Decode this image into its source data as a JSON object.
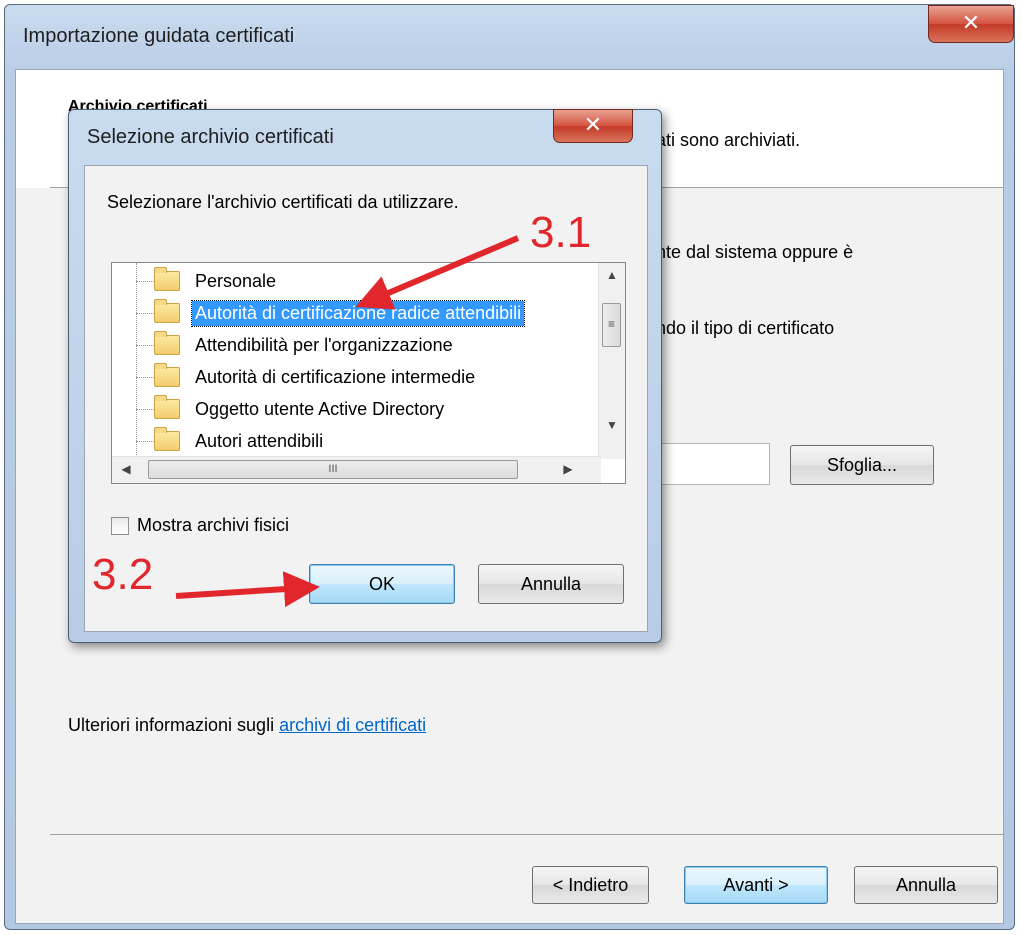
{
  "window": {
    "title": "Importazione guidata certificati",
    "close_glyph": "✕"
  },
  "wizard": {
    "header_title": "Archivio certificati",
    "header_desc_visible": "ati sono archiviati.",
    "line1_visible": "nte dal sistema oppure è",
    "line2_visible": "ndo il tipo di certificato",
    "browse_label": "Sfoglia...",
    "info_text": "Ulteriori informazioni sugli ",
    "info_link": "archivi di certificati",
    "back_label": "< Indietro",
    "next_label": "Avanti >",
    "cancel_label": "Annulla"
  },
  "dialog": {
    "title": "Selezione archivio certificati",
    "close_glyph": "✕",
    "prompt": "Selezionare l'archivio certificati da utilizzare.",
    "tree_items": [
      {
        "label": "Personale",
        "selected": false
      },
      {
        "label": "Autorità di certificazione radice attendibili",
        "selected": true
      },
      {
        "label": "Attendibilità per l'organizzazione",
        "selected": false
      },
      {
        "label": "Autorità di certificazione intermedie",
        "selected": false
      },
      {
        "label": "Oggetto utente Active Directory",
        "selected": false
      },
      {
        "label": "Autori attendibili",
        "selected": false
      }
    ],
    "show_physical_label": "Mostra archivi fisici",
    "show_physical_checked": false,
    "ok_label": "OK",
    "cancel_label": "Annulla"
  },
  "annotations": {
    "step1": "3.1",
    "step2": "3.2",
    "arrow_color": "#e1262c"
  },
  "icons": {
    "folder": "folder-icon",
    "scroll_up": "▲",
    "scroll_down": "▼",
    "scroll_left": "◀",
    "scroll_right": "▶",
    "grip_v": "≡",
    "grip_h": "III"
  }
}
